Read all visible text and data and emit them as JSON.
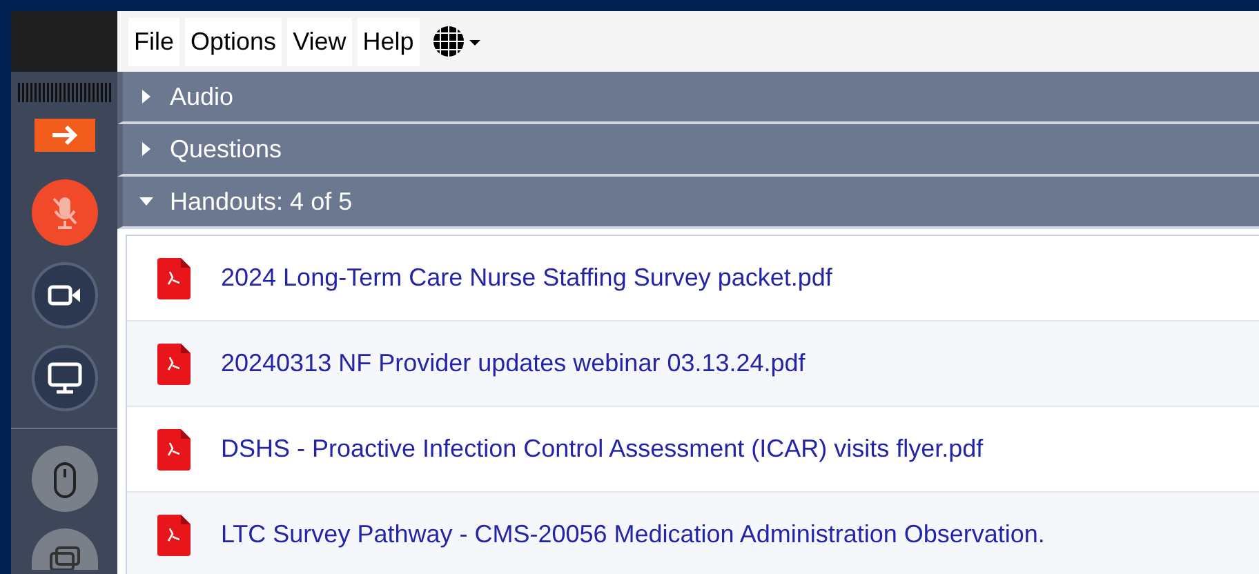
{
  "menu_bar": {
    "items": [
      "File",
      "Options",
      "View",
      "Help"
    ]
  },
  "sections": [
    {
      "title": "Audio",
      "expanded": false
    },
    {
      "title": "Questions",
      "expanded": false
    },
    {
      "title": "Handouts: 4 of 5",
      "expanded": true,
      "files": [
        {
          "name": "2024 Long-Term Care Nurse Staffing Survey packet.pdf"
        },
        {
          "name": "20240313 NF Provider updates webinar 03.13.24.pdf"
        },
        {
          "name": "DSHS - Proactive Infection Control Assessment (ICAR) visits flyer.pdf"
        },
        {
          "name": "LTC Survey Pathway - CMS-20056 Medication Administration Observation."
        }
      ]
    }
  ]
}
